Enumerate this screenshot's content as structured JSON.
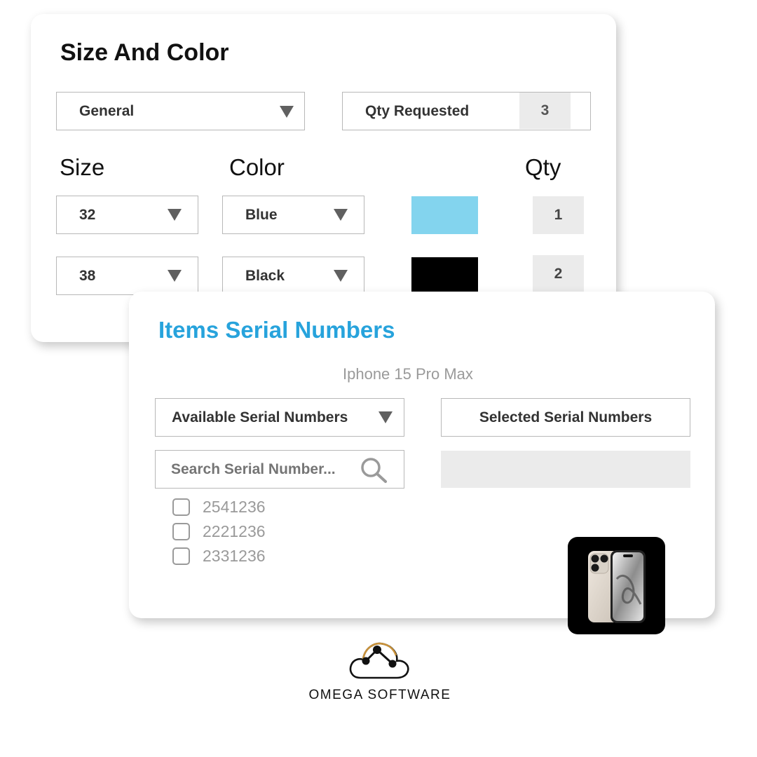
{
  "size_color": {
    "title": "Size And Color",
    "category_select": {
      "value": "General"
    },
    "qty_requested": {
      "label": "Qty Requested",
      "value": "3"
    },
    "headers": {
      "size": "Size",
      "color": "Color",
      "qty": "Qty"
    },
    "rows": [
      {
        "size": "32",
        "color": "Blue",
        "swatch": "#83d4ee",
        "qty": "1"
      },
      {
        "size": "38",
        "color": "Black",
        "swatch": "#000000",
        "qty": "2"
      }
    ]
  },
  "serial": {
    "title": "Items Serial Numbers",
    "product": "Iphone 15 Pro Max",
    "available_select": {
      "value": "Available Serial Numbers"
    },
    "selected_button": {
      "label": "Selected Serial Numbers"
    },
    "search": {
      "placeholder": "Search Serial Number..."
    },
    "items": [
      "2541236",
      "2221236",
      "2331236"
    ],
    "selected_list": []
  },
  "brand": {
    "name": "OMEGA SOFTWARE"
  },
  "colors": {
    "accent": "#27a3dc",
    "cell_bg": "#ebebeb"
  },
  "icons": [
    "chevron-down-icon",
    "search-icon",
    "checkbox-icon",
    "phone-image",
    "cloud-logo-icon"
  ]
}
